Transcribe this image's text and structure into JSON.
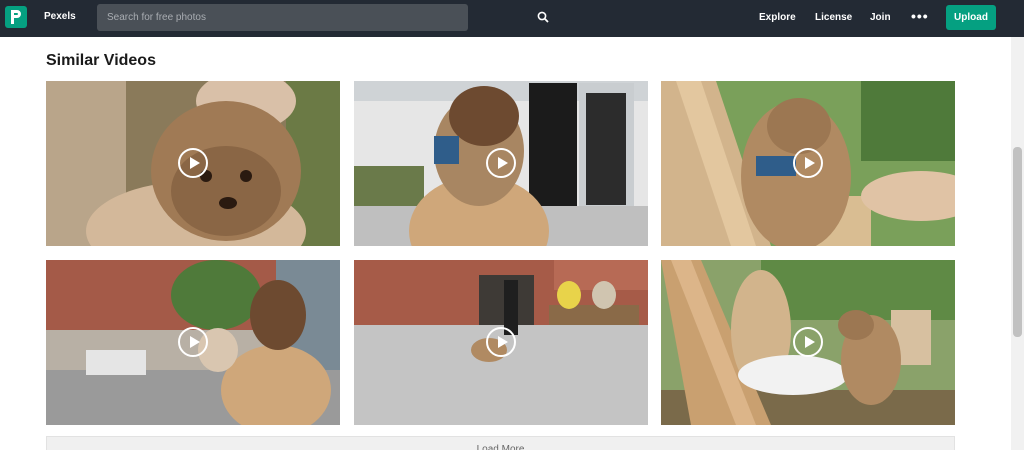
{
  "header": {
    "brand": "Pexels",
    "search_placeholder": "Search for free photos",
    "nav": {
      "explore": "Explore",
      "license": "License",
      "join": "Join",
      "more": "•••",
      "upload": "Upload"
    },
    "colors": {
      "bar": "#232a34",
      "accent": "#05a081"
    }
  },
  "section": {
    "title": "Similar Videos",
    "videos": [
      {
        "thumbnail": "woman holding curly dog close-up"
      },
      {
        "thumbnail": "woman hugging dog near doorway"
      },
      {
        "thumbnail": "dog on wooden bench being petted"
      },
      {
        "thumbnail": "woman with dog on street"
      },
      {
        "thumbnail": "dog walking in city square"
      },
      {
        "thumbnail": "woman on bench with dog in garden"
      }
    ],
    "load_more": "Load More"
  }
}
